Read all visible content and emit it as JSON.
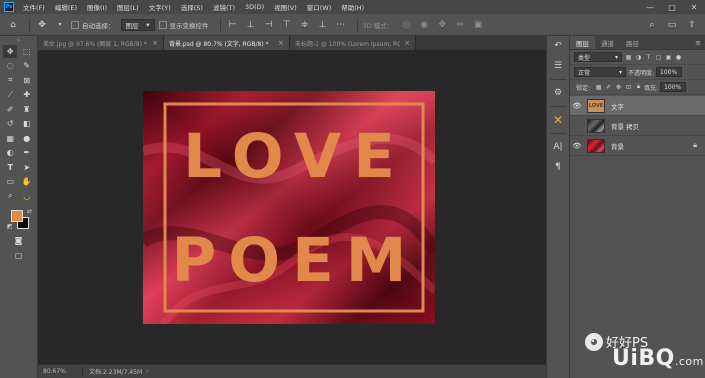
{
  "menubar": {
    "app_icon": "Ps",
    "items": [
      "文件(F)",
      "编辑(E)",
      "图像(I)",
      "图层(L)",
      "文字(Y)",
      "选择(S)",
      "滤镜(T)",
      "3D(D)",
      "视图(V)",
      "窗口(W)",
      "帮助(H)"
    ],
    "window_controls": [
      "—",
      "□",
      "✕"
    ]
  },
  "options_bar": {
    "home_icon": "home-icon",
    "move_icon": "move-icon",
    "auto_select_label": "自动选择：",
    "auto_select_value": "图层",
    "show_transform_label": "显示变换控件",
    "mode_3d_label": "3D 模式：",
    "search_icon": "search-icon",
    "workspace_icon": "workspace-icon",
    "share_icon": "share-icon"
  },
  "tabs": [
    {
      "label": "美女.jpg @ 97.6% (图层 1, RGB/8) *",
      "active": false
    },
    {
      "label": "背景.psd @ 80.7% (文字, RGB/8) *",
      "active": true
    },
    {
      "label": "未标题-1 @ 100% (Lorem Ipsum, RGB/8) *",
      "active": false
    }
  ],
  "artwork": {
    "line1": "LOVE",
    "line2": "POEM",
    "text_color": "#e0894a",
    "frame_color": "#e0894a"
  },
  "statusbar": {
    "zoom": "80.67%",
    "doc_info": "文档:2.23M/7.45M"
  },
  "colors": {
    "foreground": "#e38a44",
    "background": "#0a0a0a",
    "accent": "#31a8ff"
  },
  "panel": {
    "tabs": [
      "图层",
      "通道",
      "路径"
    ],
    "kind_filter": "类型",
    "blend_mode": "正常",
    "opacity_label": "不透明度:",
    "opacity_value": "100%",
    "lock_label": "锁定:",
    "fill_label": "填充:",
    "fill_value": "100%",
    "layers": [
      {
        "name": "文字",
        "visible": true,
        "selected": true,
        "thumb_text": "LOVE"
      },
      {
        "name": "背景 拷贝",
        "visible": false,
        "selected": false
      },
      {
        "name": "背景",
        "visible": true,
        "selected": false,
        "locked": true
      }
    ]
  },
  "watermark": {
    "brand": "好好PS",
    "site": "UiBQ",
    "site_suffix": ".com"
  }
}
